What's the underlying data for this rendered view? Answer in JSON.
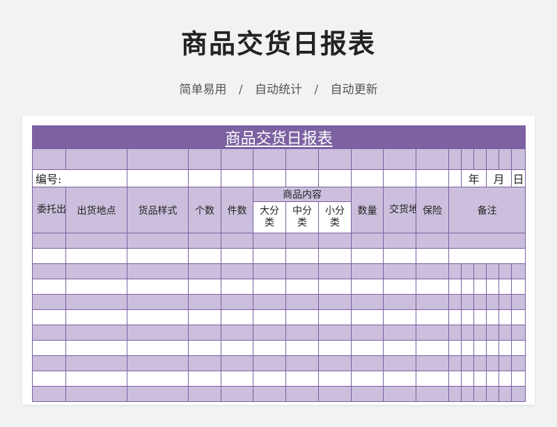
{
  "page": {
    "title": "商品交货日报表",
    "subtitle": [
      "简单易用",
      "自动统计",
      "自动更新"
    ],
    "subtitle_sep": "/"
  },
  "sheet": {
    "title": "商品交货日报表",
    "number_label": "编号:",
    "date": {
      "year": "年",
      "month": "月",
      "day": "日"
    },
    "headers": {
      "consign_no": "委托出货编号",
      "ship_place": "出货地点",
      "style": "货品样式",
      "count": "个数",
      "pieces": "件数",
      "content": "商品内容",
      "big_cat": "大分类",
      "mid_cat": "中分类",
      "small_cat": "小分类",
      "quantity": "数量",
      "delivery_place": "交货地点",
      "insurance": "保险",
      "remarks": "备注"
    }
  },
  "colors": {
    "title_bg": "#7c62a2",
    "lavender": "#cbbfdd",
    "border": "#7a5ea0"
  }
}
